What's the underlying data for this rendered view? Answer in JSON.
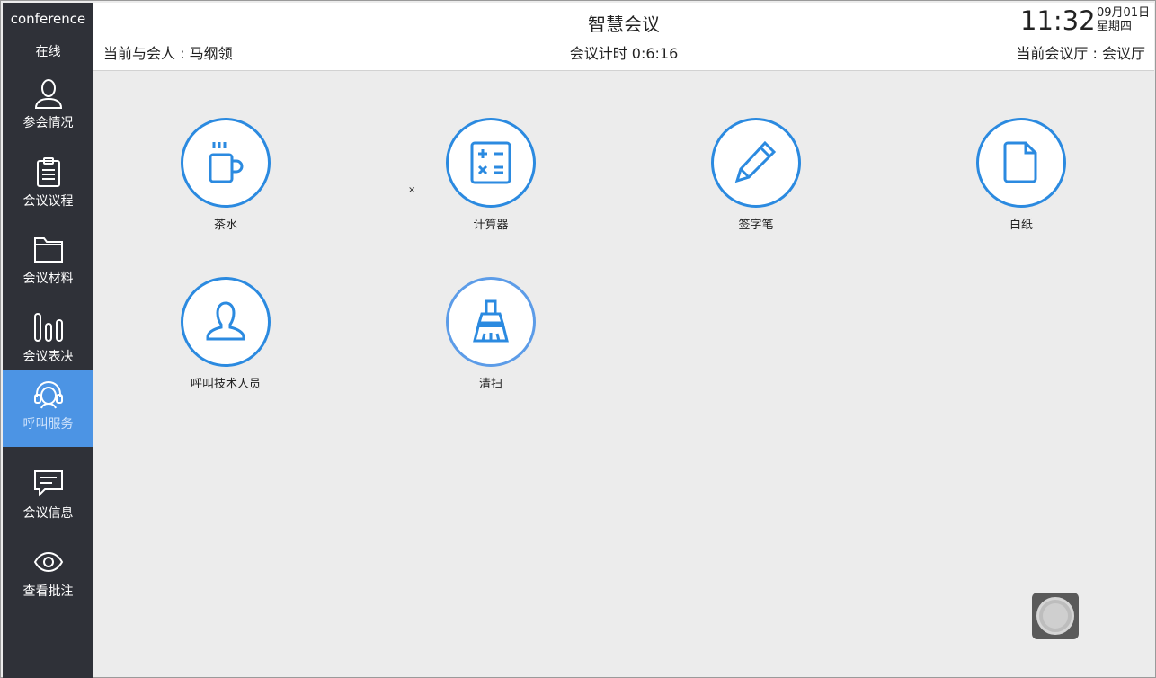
{
  "sidebar": {
    "brand": "conference",
    "status": "在线",
    "items": [
      {
        "label": "参会情况",
        "icon": "person-icon"
      },
      {
        "label": "会议议程",
        "icon": "clipboard-icon"
      },
      {
        "label": "会议材料",
        "icon": "folder-icon"
      },
      {
        "label": "会议表决",
        "icon": "bar-chart-icon"
      },
      {
        "label": "呼叫服务",
        "icon": "headset-icon",
        "active": true
      },
      {
        "label": "会议信息",
        "icon": "message-icon"
      },
      {
        "label": "查看批注",
        "icon": "eye-icon"
      }
    ]
  },
  "header": {
    "title": "智慧会议",
    "attendee": "当前与会人 : 马纲领",
    "timer": "会议计时  0:6:16",
    "clock": "11:32",
    "date": "09月01日",
    "weekday": "星期四",
    "room": "当前会议厅 : 会议厅"
  },
  "services": [
    {
      "label": "茶水",
      "icon": "tea-cup-icon"
    },
    {
      "label": "计算器",
      "icon": "calculator-icon"
    },
    {
      "label": "签字笔",
      "icon": "pen-icon"
    },
    {
      "label": "白纸",
      "icon": "paper-icon"
    },
    {
      "label": "呼叫技术人员",
      "icon": "technician-icon"
    },
    {
      "label": "清扫",
      "icon": "broom-icon"
    }
  ],
  "cursor_glyph": "×",
  "colors": {
    "accent": "#2b8ae0",
    "sidebar_bg": "#2f3138",
    "active_nav": "#4c94e4",
    "content_bg": "#ececec"
  }
}
